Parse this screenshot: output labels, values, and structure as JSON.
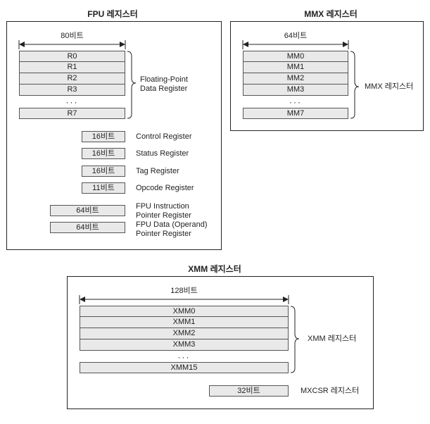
{
  "fpu": {
    "title": "FPU 레지스터",
    "width_label": "80비트",
    "registers": [
      "R0",
      "R1",
      "R2",
      "R3"
    ],
    "ellipsis": "···",
    "last_register": "R7",
    "group_label": "Floating-Point\nData Register",
    "control": {
      "bits": "16비트",
      "label": "Control Register"
    },
    "status": {
      "bits": "16비트",
      "label": "Status Register"
    },
    "tag": {
      "bits": "16비트",
      "label": "Tag Register"
    },
    "opcode": {
      "bits": "11비트",
      "label": "Opcode Register"
    },
    "instr_ptr": {
      "bits": "64비트",
      "label": "FPU Instruction\nPointer Register"
    },
    "data_ptr": {
      "bits": "64비트",
      "label": "FPU Data (Operand)\nPointer Register"
    }
  },
  "mmx": {
    "title": "MMX 레지스터",
    "width_label": "64비트",
    "registers": [
      "MM0",
      "MM1",
      "MM2",
      "MM3"
    ],
    "ellipsis": "···",
    "last_register": "MM7",
    "group_label": "MMX 레지스터"
  },
  "xmm": {
    "title": "XMM 레지스터",
    "width_label": "128비트",
    "registers": [
      "XMM0",
      "XMM1",
      "XMM2",
      "XMM3"
    ],
    "ellipsis": "···",
    "last_register": "XMM15",
    "group_label": "XMM 레지스터",
    "mxcsr": {
      "bits": "32비트",
      "label": "MXCSR 레지스터"
    }
  }
}
